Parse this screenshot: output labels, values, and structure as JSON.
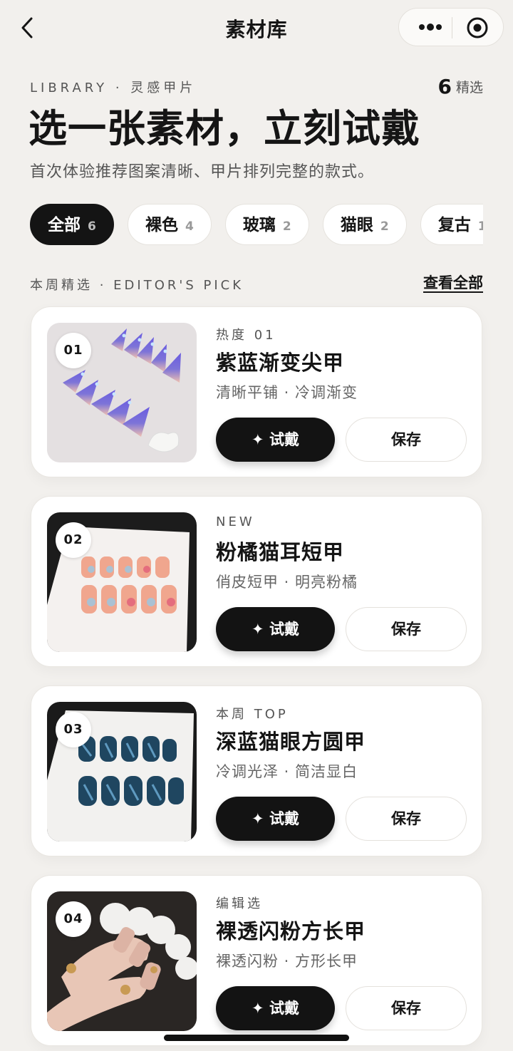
{
  "nav": {
    "title": "素材库",
    "back_icon": "chevron-left-icon",
    "more_icon": "more-dots-icon",
    "close_icon": "target-circle-icon"
  },
  "header": {
    "eyebrow": "LIBRARY · 灵感甲片",
    "count": "6",
    "count_label": "精选",
    "headline": "选一张素材，立刻试戴",
    "subline": "首次体验推荐图案清晰、甲片排列完整的款式。"
  },
  "chips": [
    {
      "label": "全部",
      "count": "6",
      "active": true
    },
    {
      "label": "裸色",
      "count": "4"
    },
    {
      "label": "玻璃",
      "count": "2"
    },
    {
      "label": "猫眼",
      "count": "2"
    },
    {
      "label": "复古",
      "count": "1"
    }
  ],
  "section": {
    "label": "本周精选 · EDITOR'S PICK",
    "link": "查看全部"
  },
  "cards": [
    {
      "badge": "01",
      "tag": "热度 01",
      "name": "紫蓝渐变尖甲",
      "desc": "清晰平铺 · 冷调渐变",
      "try_label": "✦ 试戴",
      "save_label": "保存"
    },
    {
      "badge": "02",
      "tag": "NEW",
      "name": "粉橘猫耳短甲",
      "desc": "俏皮短甲 · 明亮粉橘",
      "try_label": "✦ 试戴",
      "save_label": "保存"
    },
    {
      "badge": "03",
      "tag": "本周 TOP",
      "name": "深蓝猫眼方圆甲",
      "desc": "冷调光泽 · 简洁显白",
      "try_label": "✦ 试戴",
      "save_label": "保存"
    },
    {
      "badge": "04",
      "tag": "编辑选",
      "name": "裸透闪粉方长甲",
      "desc": "裸透闪粉 · 方形长甲",
      "try_label": "✦ 试戴",
      "save_label": "保存"
    }
  ],
  "colors": {
    "background": "#f2f0ed",
    "ink": "#151515",
    "card": "#ffffff",
    "primary_button": "#131313"
  }
}
